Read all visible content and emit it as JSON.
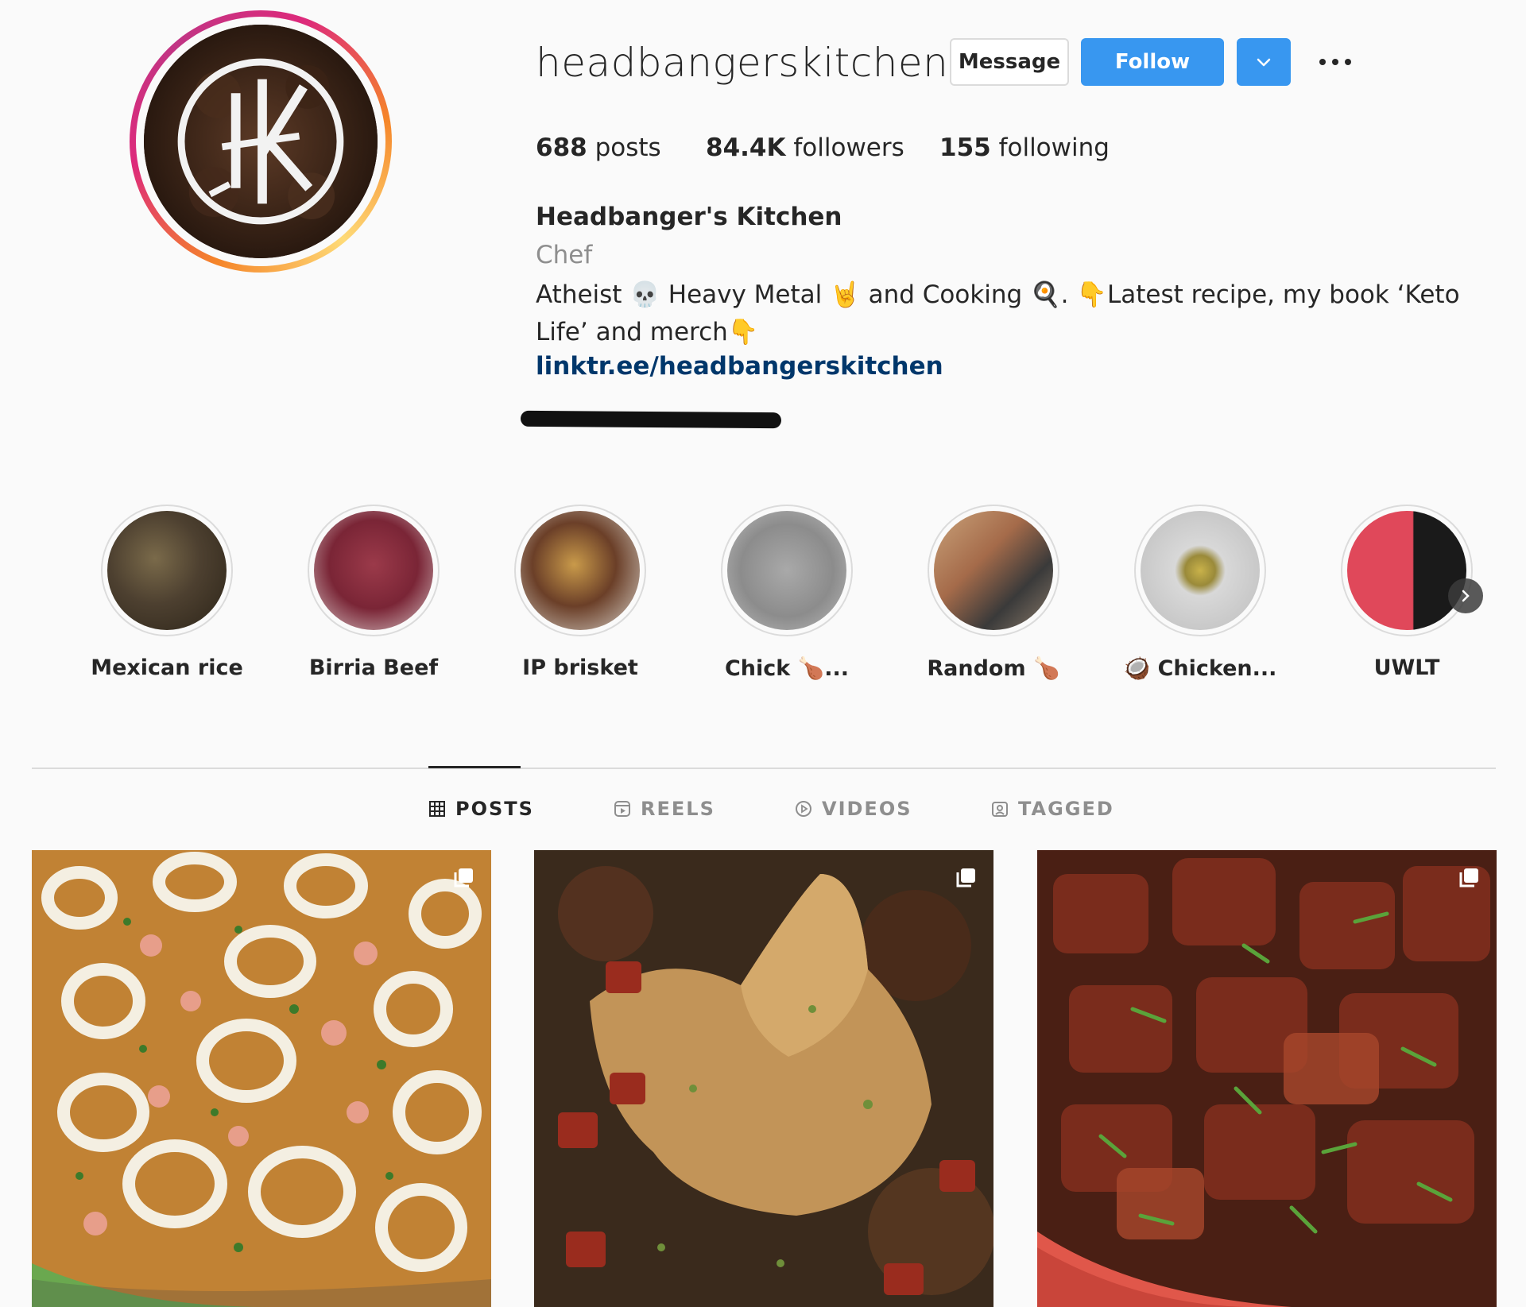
{
  "profile": {
    "username": "headbangerskitchen",
    "buttons": {
      "message": "Message",
      "follow": "Follow"
    },
    "stats": {
      "posts_count": "688",
      "posts_label": " posts",
      "followers_count": "84.4K",
      "followers_label": " followers",
      "following_count": "155",
      "following_label": " following"
    },
    "full_name": "Headbanger's Kitchen",
    "category": "Chef",
    "bio": "Atheist 💀 Heavy Metal 🤘 and Cooking 🍳. 👇Latest recipe, my book ‘Keto Life’ and merch👇",
    "link": "linktr.ee/headbangerskitchen"
  },
  "highlights": [
    {
      "label": "Mexican rice"
    },
    {
      "label": "Birria Beef"
    },
    {
      "label": "IP brisket"
    },
    {
      "label": "Chick 🍗..."
    },
    {
      "label": "Random 🍗"
    },
    {
      "label": "🥥 Chicken..."
    },
    {
      "label": "UWLT"
    }
  ],
  "tabs": [
    {
      "label": "POSTS",
      "icon": "grid-icon",
      "active": true
    },
    {
      "label": "REELS",
      "icon": "reels-icon"
    },
    {
      "label": "VIDEOS",
      "icon": "play-icon"
    },
    {
      "label": "TAGGED",
      "icon": "tagged-icon"
    }
  ],
  "posts": [
    {
      "subject": "seafood paella with calamari rings and shrimp"
    },
    {
      "subject": "roast chicken leg with chorizo and mushrooms"
    },
    {
      "subject": "braised beef stew with chives"
    }
  ],
  "colors": {
    "accent": "#3897f0",
    "link": "#00376b",
    "muted": "#8e8e8e",
    "text": "#262626"
  }
}
